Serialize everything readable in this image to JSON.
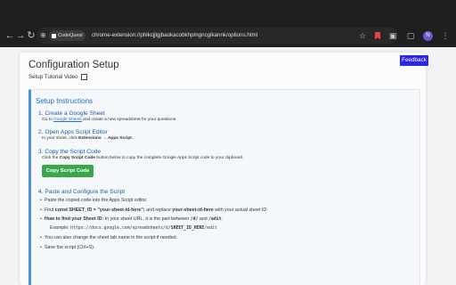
{
  "browser": {
    "chip_label": "CodeQuest",
    "url": "chrome-extension://phlkcjjlgjbaokacobkhpmgncglkannk/options.html"
  },
  "page": {
    "feedback_label": "Feedback",
    "title": "Configuration Setup",
    "tutorial_link": "Setup Tutorial Video",
    "instructions_title": "Setup Instructions"
  },
  "steps": [
    {
      "head": "1. Create a Google Sheet",
      "desc_pre": "Go to ",
      "desc_link": "Google Sheets",
      "desc_post": " and create a new spreadsheet for your questions."
    },
    {
      "head": "2. Open Apps Script Editor",
      "desc_pre": "In your sheet, click ",
      "desc_bold": "Extensions → Apps Script",
      "desc_post": "."
    },
    {
      "head": "3. Copy the Script Code",
      "desc_pre": "Click the ",
      "desc_bold": "Copy Script Code",
      "desc_post": " button below to copy the complete Google Apps Script code to your clipboard."
    },
    {
      "head": "4. Paste and Configure the Script"
    }
  ],
  "copy_button": "Copy Script Code",
  "bullets": {
    "b1": "Paste the copied code into the Apps Script editor.",
    "b2_pre": "Find ",
    "b2_code": "const SHEET_ID = \"your-sheet-id-here\";",
    "b2_mid": " and replace ",
    "b2_bold": "your-sheet-id-here",
    "b2_post": " with your actual sheet ID.",
    "b3_bold": "How to find your Sheet ID:",
    "b3_pre": " In your sheet URL, it is the part between ",
    "b3_c1": "/d/",
    "b3_mid": " and ",
    "b3_c2": "/edit",
    "b3_post": ".",
    "example_label": "Example: ",
    "example_pre": "https://docs.google.com/spreadsheets/d/",
    "example_bold": "SHEET_ID_HERE",
    "example_post": "/edit",
    "b4": "You can also change the sheet tab name in the script if needed.",
    "b5": "Save the script (Ctrl+S)."
  }
}
